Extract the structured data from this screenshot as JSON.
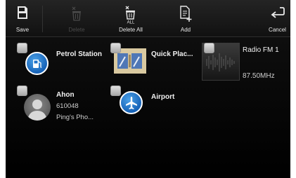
{
  "toolbar": {
    "save": {
      "label": "Save",
      "icon": "save-icon",
      "enabled": true
    },
    "delete": {
      "label": "Delete",
      "icon": "trash-icon",
      "enabled": false
    },
    "delete_all": {
      "label": "Delete All",
      "icon": "delete-all-icon",
      "enabled": true
    },
    "add": {
      "label": "Add",
      "icon": "add-file-icon",
      "enabled": true
    },
    "cancel": {
      "label": "Cancel",
      "icon": "return-arrow-icon",
      "enabled": true
    }
  },
  "items": {
    "petrol": {
      "title": "Petrol Station",
      "icon": "fuel-pump-icon"
    },
    "quick": {
      "title": "Quick Plac...",
      "icon": "map-icon"
    },
    "radio": {
      "title": "Radio FM 1",
      "frequency": "87.50MHz"
    },
    "contact": {
      "title": "Ahon",
      "number": "610048",
      "phone": "Ping's Pho..."
    },
    "airport": {
      "title": "Airport",
      "icon": "airplane-icon"
    }
  },
  "colors": {
    "background": "#000000",
    "toolbar": "#1c1c1c",
    "accent_blue": "#1f73c9",
    "text": "#f2f2f2"
  }
}
